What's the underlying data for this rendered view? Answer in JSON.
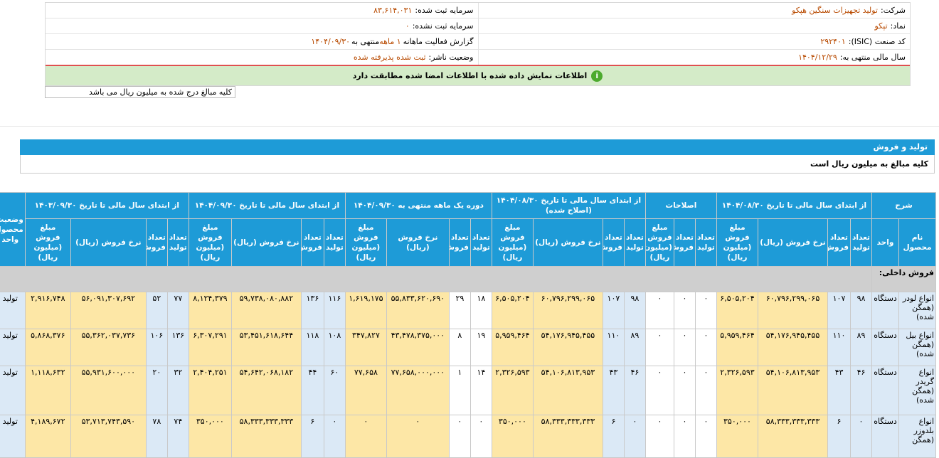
{
  "header": {
    "company_label": "شرکت:",
    "company_value": "تولید تجهیزات سنگین هپکو",
    "reg_capital_label": "سرمایه ثبت شده:",
    "reg_capital_value": "۸۳,۶۱۴,۰۳۱",
    "symbol_label": "نماد:",
    "symbol_value": "تپکو",
    "unreg_capital_label": "سرمایه ثبت نشده:",
    "unreg_capital_value": "۰",
    "isic_label": "کد صنعت (ISIC):",
    "isic_value": "۲۹۲۴۰۱",
    "report_label": "گزارش فعالیت ماهانه",
    "report_value": "۱ ماهه",
    "report_suffix": "منتهی به",
    "report_date": "۱۴۰۴/۰۹/۳۰",
    "fiscal_label": "سال مالی منتهی به:",
    "fiscal_value": "۱۴۰۴/۱۲/۲۹",
    "status_label": "وضعیت ناشر:",
    "status_value": "ثبت شده پذیرفته شده"
  },
  "notice": "اطلاعات نمایش داده شده با اطلاعات امضا شده مطابقت دارد",
  "amount_note": "کلیه مبالغ درج شده به میلیون ریال می باشد",
  "section": {
    "title": "تولید و فروش",
    "subtitle": "کلیه مبالغ به میلیون ریال است"
  },
  "table": {
    "groups": {
      "desc": "شرح",
      "g1": "از ابتدای سال مالی تا تاریخ ۱۴۰۴/۰۸/۳۰",
      "g2": "اصلاحات",
      "g3": "از ابتدای سال مالی تا تاریخ ۱۴۰۴/۰۸/۳۰ (اصلاح شده)",
      "g4": "دوره یک ماهه منتهی به ۱۴۰۴/۰۹/۳۰",
      "g5": "از ابتدای سال مالی تا تاریخ ۱۴۰۴/۰۹/۳۰",
      "g6": "از ابتدای سال مالی تا تاریخ ۱۴۰۳/۰۹/۳۰",
      "status": "وضعیت محصول-واحد"
    },
    "sub": {
      "name": "نام محصول",
      "unit": "واحد",
      "prod": "تعداد تولید",
      "sale": "تعداد فروش",
      "rate": "نرخ فروش (ریال)",
      "amount": "مبلغ فروش (میلیون ریال)"
    },
    "group_row": "فروش داخلی:",
    "rows": [
      {
        "name": "انواع لودر (همگن شده)",
        "unit": "دستگاه",
        "a": [
          "۹۸",
          "۱۰۷",
          "۶۰,۷۹۶,۲۹۹,۰۶۵",
          "۶,۵۰۵,۲۰۴"
        ],
        "b": [
          "۰",
          "۰",
          "۰"
        ],
        "c": [
          "۹۸",
          "۱۰۷",
          "۶۰,۷۹۶,۲۹۹,۰۶۵",
          "۶,۵۰۵,۲۰۴"
        ],
        "d": [
          "۱۸",
          "۲۹",
          "۵۵,۸۳۳,۶۲۰,۶۹۰",
          "۱,۶۱۹,۱۷۵"
        ],
        "e": [
          "۱۱۶",
          "۱۳۶",
          "۵۹,۷۳۸,۰۸۰,۸۸۲",
          "۸,۱۲۴,۳۷۹"
        ],
        "f": [
          "۷۷",
          "۵۲",
          "۵۶,۰۹۱,۳۰۷,۶۹۲",
          "۲,۹۱۶,۷۴۸"
        ],
        "status": "تولید"
      },
      {
        "name": "انواع بیل (همگن شده)",
        "unit": "دستگاه",
        "a": [
          "۸۹",
          "۱۱۰",
          "۵۴,۱۷۶,۹۴۵,۴۵۵",
          "۵,۹۵۹,۴۶۴"
        ],
        "b": [
          "۰",
          "۰",
          "۰"
        ],
        "c": [
          "۸۹",
          "۱۱۰",
          "۵۴,۱۷۶,۹۴۵,۴۵۵",
          "۵,۹۵۹,۴۶۴"
        ],
        "d": [
          "۱۹",
          "۸",
          "۴۳,۴۷۸,۳۷۵,۰۰۰",
          "۳۴۷,۸۲۷"
        ],
        "e": [
          "۱۰۸",
          "۱۱۸",
          "۵۳,۴۵۱,۶۱۸,۶۴۴",
          "۶,۳۰۷,۲۹۱"
        ],
        "f": [
          "۱۳۶",
          "۱۰۶",
          "۵۵,۳۶۲,۰۳۷,۷۳۶",
          "۵,۸۶۸,۳۷۶"
        ],
        "status": "تولید"
      },
      {
        "name": "انواع گریدر (همگن شده)",
        "unit": "دستگاه",
        "a": [
          "۴۶",
          "۴۳",
          "۵۴,۱۰۶,۸۱۳,۹۵۳",
          "۲,۳۲۶,۵۹۳"
        ],
        "b": [
          "۰",
          "۰",
          "۰"
        ],
        "c": [
          "۴۶",
          "۴۳",
          "۵۴,۱۰۶,۸۱۳,۹۵۳",
          "۲,۳۲۶,۵۹۳"
        ],
        "d": [
          "۱۴",
          "۱",
          "۷۷,۶۵۸,۰۰۰,۰۰۰",
          "۷۷,۶۵۸"
        ],
        "e": [
          "۶۰",
          "۴۴",
          "۵۴,۶۴۲,۰۶۸,۱۸۲",
          "۲,۴۰۴,۲۵۱"
        ],
        "f": [
          "۳۲",
          "۲۰",
          "۵۵,۹۳۱,۶۰۰,۰۰۰",
          "۱,۱۱۸,۶۳۲"
        ],
        "status": "تولید"
      },
      {
        "name": "انواع بلدوزر (همگن",
        "unit": "دستگاه",
        "a": [
          "۰",
          "۶",
          "۵۸,۳۳۳,۳۳۳,۳۳۳",
          "۳۵۰,۰۰۰"
        ],
        "b": [
          "۰",
          "۰",
          "۰"
        ],
        "c": [
          "۰",
          "۶",
          "۵۸,۳۳۳,۳۳۳,۳۳۳",
          "۳۵۰,۰۰۰"
        ],
        "d": [
          "۰",
          "۰",
          "۰",
          "۰"
        ],
        "e": [
          "۰",
          "۶",
          "۵۸,۳۳۳,۳۳۳,۳۳۳",
          "۳۵۰,۰۰۰"
        ],
        "f": [
          "۷۴",
          "۷۸",
          "۵۳,۷۱۳,۷۴۳,۵۹۰",
          "۴,۱۸۹,۶۷۲"
        ],
        "status": "تولید"
      }
    ]
  }
}
